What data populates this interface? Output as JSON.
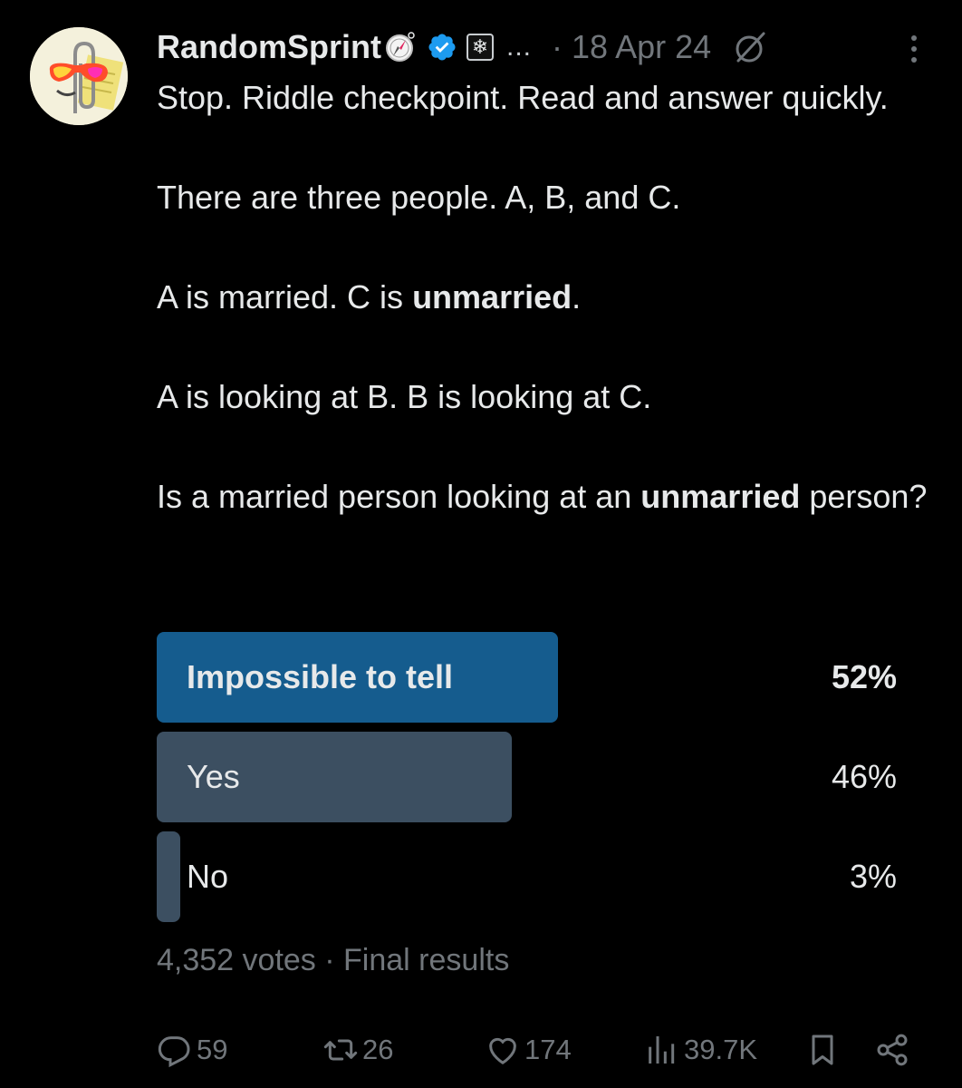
{
  "colors": {
    "background": "#000000",
    "text": "#e7e9ea",
    "muted": "#71767b",
    "verified": "#1d9bf0",
    "poll_winner": "#155c8e",
    "poll_other": "#3c4f61"
  },
  "author": {
    "name": "RandomSprint",
    "avatar_icon": "clippy-with-sunglasses-avatar",
    "badges": [
      "compass-icon",
      "verified-badge-icon",
      "snowflake-box-icon"
    ],
    "ellipsis": "...",
    "date": "· 18 Apr 24"
  },
  "tweet": {
    "paragraphs": [
      {
        "segments": [
          {
            "text": "Stop. Riddle checkpoint. Read and answer quickly.",
            "bold": false
          }
        ]
      },
      {
        "segments": [
          {
            "text": "There are three people. A, B, and C.",
            "bold": false
          }
        ]
      },
      {
        "segments": [
          {
            "text": "A is married. C is ",
            "bold": false
          },
          {
            "text": "unmarried",
            "bold": true
          },
          {
            "text": ".",
            "bold": false
          }
        ]
      },
      {
        "segments": [
          {
            "text": "A is looking at B. B is looking at C.",
            "bold": false
          }
        ]
      },
      {
        "segments": [
          {
            "text": "Is a married person looking at an ",
            "bold": false
          },
          {
            "text": "unmarried",
            "bold": true
          },
          {
            "text": " person?",
            "bold": false
          }
        ]
      }
    ]
  },
  "poll": {
    "options": [
      {
        "label": "Impossible to tell",
        "percent": "52%",
        "fraction": 0.52,
        "winner": true
      },
      {
        "label": "Yes",
        "percent": "46%",
        "fraction": 0.46,
        "winner": false
      },
      {
        "label": "No",
        "percent": "3%",
        "fraction": 0.03,
        "winner": false
      }
    ],
    "votes": "4,352 votes",
    "status": "Final results"
  },
  "actions": {
    "replies": "59",
    "reposts": "26",
    "likes": "174",
    "views": "39.7K"
  }
}
